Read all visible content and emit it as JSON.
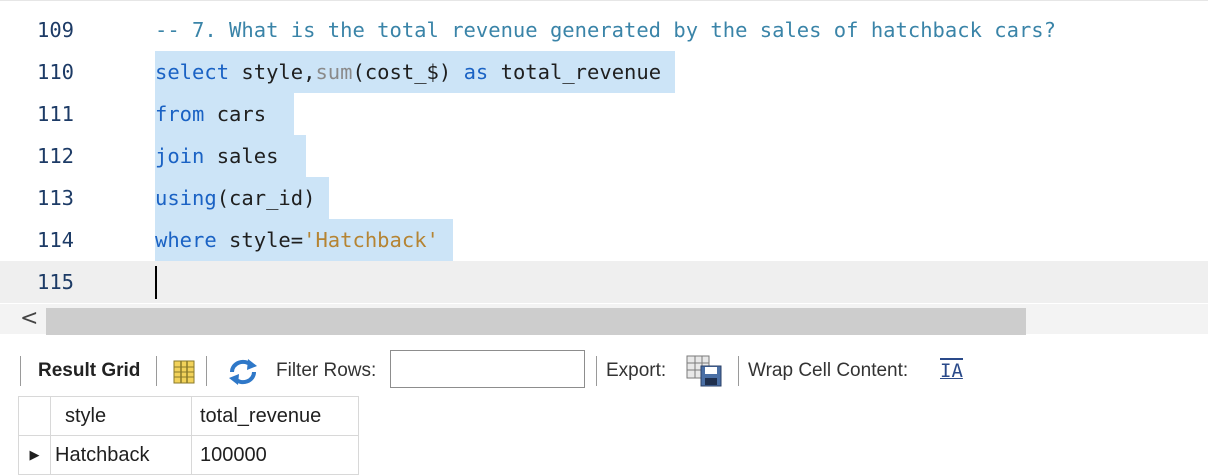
{
  "editor": {
    "lines": [
      {
        "number": "109",
        "tokens": [
          {
            "t": "-- 7. What is the total revenue generated by the sales of hatchback cars?",
            "c": "comment"
          }
        ]
      },
      {
        "number": "110",
        "tokens": [
          {
            "t": "select",
            "c": "kw"
          },
          {
            "t": " style,",
            "c": "txt"
          },
          {
            "t": "sum",
            "c": "fn"
          },
          {
            "t": "(cost_$) ",
            "c": "txt"
          },
          {
            "t": "as",
            "c": "kw"
          },
          {
            "t": " total_revenue",
            "c": "txt"
          }
        ]
      },
      {
        "number": "111",
        "tokens": [
          {
            "t": "from",
            "c": "kw"
          },
          {
            "t": " cars",
            "c": "txt"
          }
        ]
      },
      {
        "number": "112",
        "tokens": [
          {
            "t": "join",
            "c": "kw"
          },
          {
            "t": " sales",
            "c": "txt"
          }
        ]
      },
      {
        "number": "113",
        "tokens": [
          {
            "t": "using",
            "c": "kw"
          },
          {
            "t": "(car_id)",
            "c": "txt"
          }
        ]
      },
      {
        "number": "114",
        "tokens": [
          {
            "t": "where",
            "c": "kw"
          },
          {
            "t": " style=",
            "c": "txt"
          },
          {
            "t": "'Hatchback'",
            "c": "str"
          }
        ]
      },
      {
        "number": "115",
        "tokens": []
      }
    ]
  },
  "scrollbar": {
    "left_arrow": "<"
  },
  "toolbar": {
    "result_grid_label": "Result Grid",
    "filter_rows_label": "Filter Rows:",
    "filter_rows_value": "",
    "export_label": "Export:",
    "wrap_label": "Wrap Cell Content:",
    "wrap_icon_glyph": "IA"
  },
  "result": {
    "columns": [
      "style",
      "total_revenue"
    ],
    "rows": [
      [
        "Hatchback",
        "100000"
      ]
    ],
    "row_marker": "▶"
  },
  "colors": {
    "selection": "#cce4f7",
    "keyword": "#1a62c4",
    "comment": "#3a84a8",
    "string": "#b58433",
    "function": "#8a8a8a"
  }
}
